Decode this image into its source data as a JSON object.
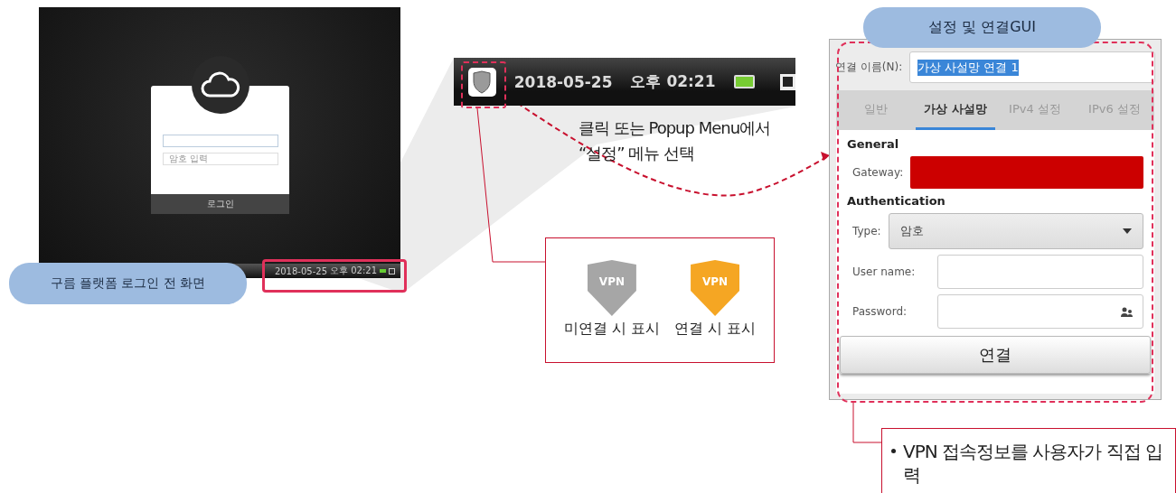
{
  "login_screen": {
    "login_button": "로그인",
    "password_placeholder": "암호 입력",
    "taskbar": {
      "date": "2018-05-25",
      "time": "오후 02:21"
    },
    "caption": "구름 플랫폼 로그인 전 화면"
  },
  "zoomed_taskbar": {
    "date": "2018-05-25",
    "time": "오후 02:21"
  },
  "instruction": "클릭 또는 Popup Menu에서\n“설정” 메뉴 선택",
  "vpn_states": [
    {
      "badge_text": "VPN",
      "label": "미연결 시 표시",
      "connected": false
    },
    {
      "badge_text": "VPN",
      "label": "연결 시 표시",
      "connected": true
    }
  ],
  "dialog": {
    "title_badge": "설정 및 연결GUI",
    "name_label": "연결 이름(N):",
    "name_value": "가상 사설망 연결 1",
    "tabs": [
      {
        "label": "일반",
        "selected": false
      },
      {
        "label": "가상 사설망",
        "selected": true
      },
      {
        "label": "IPv4 설정",
        "selected": false
      },
      {
        "label": "IPv6 설정",
        "selected": false
      }
    ],
    "general_heading": "General",
    "gateway_label": "Gateway:",
    "auth_heading": "Authentication",
    "type_label": "Type:",
    "type_value": "암호",
    "username_label": "User name:",
    "password_label": "Password:",
    "connect_button": "연결"
  },
  "note": "VPN 접속정보를 사용자가 직접 입력"
}
